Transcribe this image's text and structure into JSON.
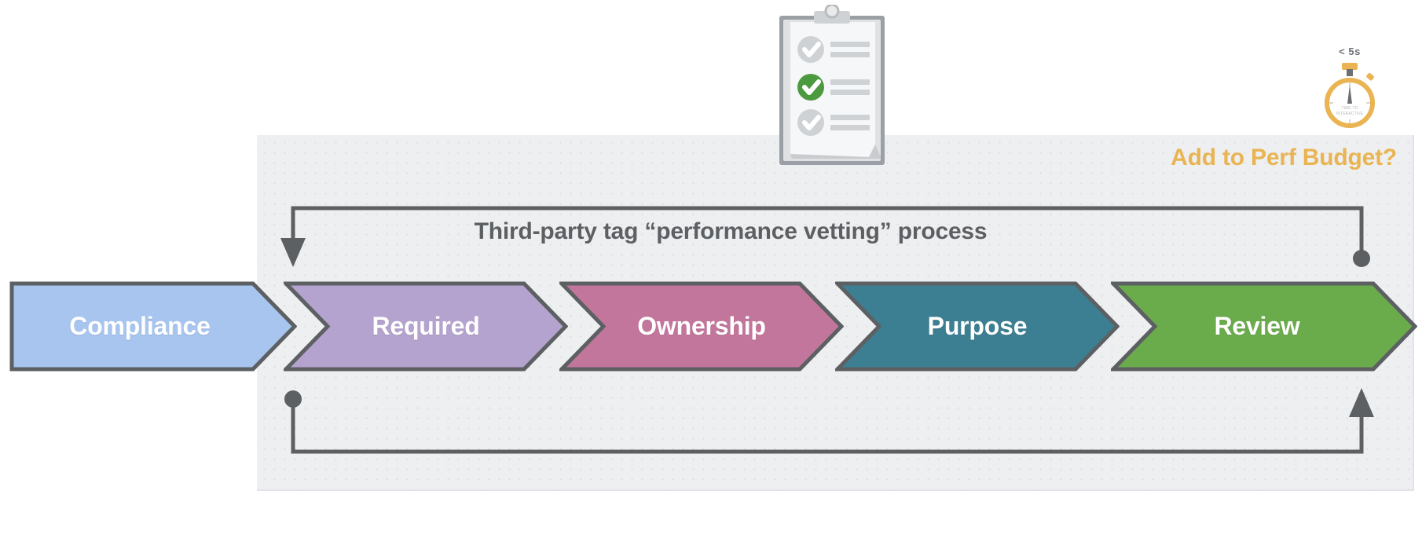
{
  "panel": {
    "header_label": "Add to Perf Budget?",
    "header_color": "#e9b451",
    "background": "#eeeff1"
  },
  "process": {
    "title": "Third-party tag “performance vetting” process",
    "title_color": "#5d6063"
  },
  "stages": [
    {
      "label": "Compliance",
      "color": "#a7c5ef",
      "stroke": "#5d6063"
    },
    {
      "label": "Required",
      "color": "#b5a3cf",
      "stroke": "#5d6063"
    },
    {
      "label": "Ownership",
      "color": "#c3769c",
      "stroke": "#5d6063"
    },
    {
      "label": "Purpose",
      "color": "#3c7f93",
      "stroke": "#5d6063"
    },
    {
      "label": "Review",
      "color": "#6aac4c",
      "stroke": "#5d6063"
    }
  ],
  "stopwatch": {
    "caption": "< 5s",
    "dial_line_1": "TIME-TO",
    "dial_line_2": "INTERACTIVE",
    "color": "#e9b451"
  },
  "clipboard": {
    "checks": [
      "grey",
      "green",
      "grey"
    ],
    "accent": "#4c9a3f"
  },
  "loops": {
    "top_arrow_direction": "down-left",
    "bottom_arrow_direction": "up-right",
    "stroke": "#5d6063"
  }
}
